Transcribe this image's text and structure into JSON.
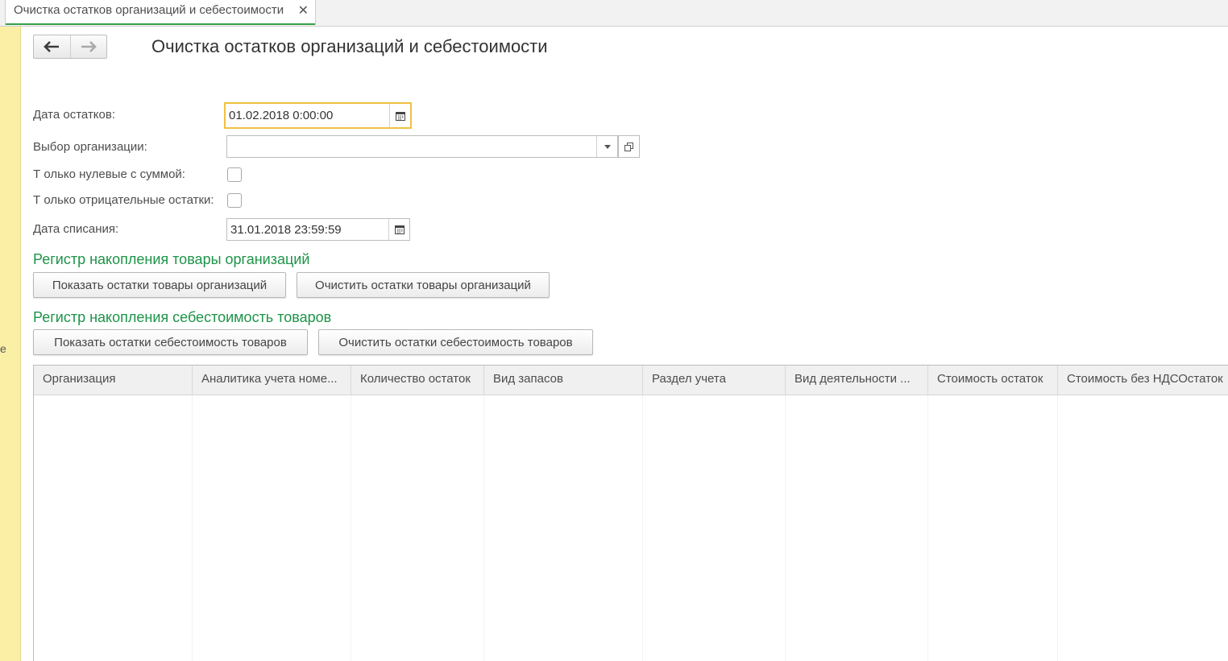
{
  "tab": {
    "title": "Очистка остатков организаций и себестоимости",
    "close": "✕"
  },
  "side": {
    "char": "е"
  },
  "page": {
    "title": "Очистка остатков организаций и себестоимости"
  },
  "form": {
    "balance_date_label": "Дата остатков:",
    "balance_date_value": "01.02.2018  0:00:00",
    "org_label": "Выбор организации:",
    "org_value": "",
    "only_zero_label": "Т олько нулевые с суммой:",
    "only_negative_label": "Т олько отрицательные остатки:",
    "writeoff_date_label": "Дата списания:",
    "writeoff_date_value": "31.01.2018 23:59:59"
  },
  "section1": {
    "title": "Регистр накопления товары организаций",
    "show_btn": "Показать остатки товары организаций",
    "clear_btn": "Очистить остатки товары организаций"
  },
  "section2": {
    "title": "Регистр накопления себестоимость товаров",
    "show_btn": "Показать остатки себестоимость товаров",
    "clear_btn": "Очистить остатки себестоимость товаров"
  },
  "table": {
    "columns": [
      "Организация",
      "Аналитика учета номе...",
      "Количество остаток",
      "Вид запасов",
      "Раздел учета",
      "Вид деятельности ...",
      "Стоимость остаток",
      "Стоимость без НДСОстаток"
    ],
    "rows": []
  }
}
